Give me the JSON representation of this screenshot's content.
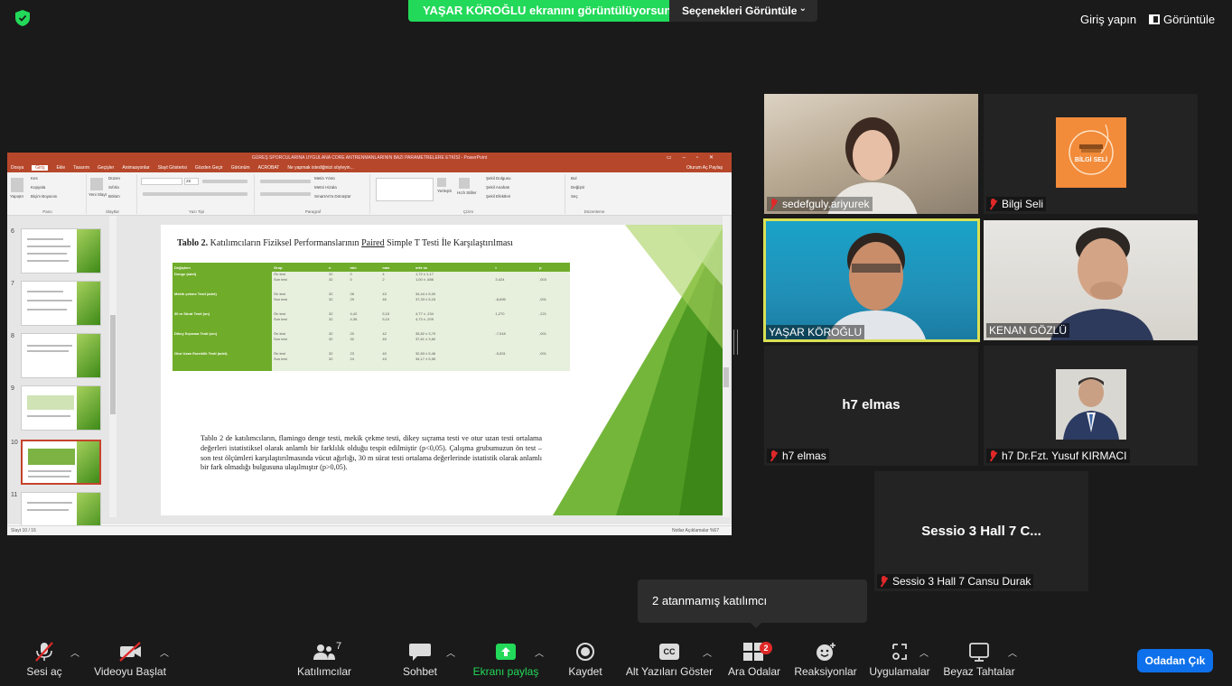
{
  "top_bar": {
    "share_banner": "YAŞAR KÖROĞLU ekranını görüntülüyorsunuz",
    "view_options": "Seçenekleri Görüntüle",
    "signin": "Giriş yapın",
    "view": "Görüntüle",
    "colors": {
      "share_green": "#23d959",
      "shield_green": "#23d959"
    }
  },
  "shared_screen": {
    "window_title": "GÜREŞ SPORCULARINA UYGULANA CORE ANTRENMANLARININ BAZI PARAMETRELERE ETKİSİ - PowerPoint",
    "tabs": [
      "Dosya",
      "Giriş",
      "Ekle",
      "Tasarım",
      "Geçişler",
      "Animasyonlar",
      "Slayt Gösterisi",
      "Gözden Geçir",
      "Görünüm",
      "ACROBAT",
      "Ne yapmak istediğinizi söyleyin..."
    ],
    "tabs_right": "Oturum Aç  Paylaş",
    "ribbon_groups": [
      "Pano",
      "Slaytlar",
      "Yazı Tipi",
      "Paragraf",
      "Çizim",
      "Düzenleme"
    ],
    "ribbon_texts": {
      "paste": "Yapıştır",
      "cut": "Kes",
      "copy": "Kopyala",
      "format_painter": "Biçim Boyacısı",
      "new_slide": "Yeni Slayt",
      "layout": "Düzen",
      "reset": "Sıfırla",
      "section": "Bölüm",
      "font_size": "28",
      "text_direction": "Metin Yönü",
      "align_text": "Metni Hizala",
      "smartart": "SmartArt'a Dönüştür",
      "arrange": "Yerleştir",
      "quick_styles": "Hızlı Stiller",
      "shape_fill": "Şekil Dolgusu",
      "shape_outline": "Şekil Anahatı",
      "shape_effects": "Şekil Efektleri",
      "find": "Bul",
      "replace": "Değiştir",
      "select": "Seç"
    },
    "thumbnail_numbers": [
      "6",
      "7",
      "8",
      "9",
      "10",
      "11"
    ],
    "slide": {
      "title_bold": "Tablo 2.",
      "title_rest": "Katılımcıların Fiziksel Performanslarının",
      "title_underlined": "Paired",
      "title_tail": "Simple T Testi İle  Karşılaştırılması",
      "table_headers": [
        "Değişken",
        "Grup",
        "n",
        "min",
        "max",
        "ort± ss",
        "t",
        "p"
      ],
      "table_rows": [
        {
          "var": "Denge (adet)",
          "rows": [
            [
              "Ön test",
              "32",
              "0",
              "4",
              "1,72  ± 1,17",
              "",
              ""
            ],
            [
              "Son test",
              "32",
              "0",
              "2",
              "1,00 ± ,686",
              "3,424",
              ",003"
            ]
          ]
        },
        {
          "var": "Mekik çekme Testi (adet)",
          "rows": [
            [
              "Ön test",
              "32",
              "26",
              "43",
              "34,44 ± 5,00",
              "",
              ""
            ],
            [
              "Son test",
              "32",
              "29",
              "46",
              "37,33 ± 5,15",
              "-8,695",
              ",001"
            ]
          ]
        },
        {
          "var": "30 m Sürat Testi (sn)",
          "rows": [
            [
              "Ön test",
              "32",
              "4,42",
              "5,15",
              "4,77 ± ,234",
              "1,270",
              ",221"
            ],
            [
              "Son test",
              "32",
              "4,36",
              "5,10",
              "4,73 ± ,209",
              "",
              ""
            ]
          ]
        },
        {
          "var": "Dikey Sıçrama Testi (cm)",
          "rows": [
            [
              "Ön test",
              "32",
              "20",
              "42",
              "35,82 ± 3,79",
              "-7,518",
              ",001"
            ],
            [
              "Son test",
              "32",
              "32",
              "45",
              "37,61 ± 3,60",
              "",
              ""
            ]
          ]
        },
        {
          "var": "Otur Uzan Esneklik Testi (adet)",
          "rows": [
            [
              "Ön test",
              "32",
              "23",
              "40",
              "32,83 ± 5,46",
              "-5,831",
              ",001"
            ],
            [
              "Son test",
              "32",
              "24",
              "43",
              "34,17 ± 5,55",
              "",
              ""
            ]
          ]
        }
      ],
      "paragraph": "Tablo 2 de katılımcıların, flamingo denge testi, mekik çekme testi, dikey sıçrama testi ve otur uzan testi ortalama değerleri istatistiksel olarak anlamlı bir farklılık olduğu tespit edilmiştir (p<0,05). Çalışma grubumuzun ön test – son test ölçümleri karşılaştırılmasında vücut ağırlığı, 30 m sürat testi ortalama değerlerinde istatistik olarak anlamlı bir fark olmadığı bulgusuna ulaşılmıştır (p>0,05)."
    },
    "status_left": "Slayt 10 / 16",
    "status_right": "Notlar   Açıklamalar          %67",
    "colors": {
      "ppt_red": "#b7472a",
      "slide_green": "#6fac29"
    }
  },
  "participants": [
    {
      "name": "sedefguly.ariyurek",
      "muted": true,
      "video": "photo"
    },
    {
      "name": "Bilgi Seli",
      "muted": true,
      "video": "logo",
      "logo_text": "BİLGİ SELİ"
    },
    {
      "name": "YAŞAR KÖROĞLU",
      "muted": false,
      "video": "photo",
      "active_speaker": true
    },
    {
      "name": "KENAN GÖZLÜ",
      "muted": false,
      "video": "photo"
    },
    {
      "name": "h7 elmas",
      "muted": true,
      "video": "off",
      "display_name": "h7 elmas"
    },
    {
      "name": "h7 Dr.Fzt. Yusuf KIRMACI",
      "muted": true,
      "video": "avatar"
    },
    {
      "name": "Sessio 3 Hall 7 Cansu Durak",
      "muted": true,
      "video": "off",
      "display_name": "Sessio 3 Hall 7 C..."
    }
  ],
  "tooltip": "2 atanmamış katılımcı",
  "toolbar": {
    "items": [
      {
        "label": "Sesi aç",
        "icon": "mic-muted-icon"
      },
      {
        "label": "Videoyu Başlat",
        "icon": "video-off-icon"
      },
      {
        "label": "Katılımcılar",
        "icon": "participants-icon",
        "count": "7"
      },
      {
        "label": "Sohbet",
        "icon": "chat-icon"
      },
      {
        "label": "Ekranı paylaş",
        "icon": "share-screen-icon"
      },
      {
        "label": "Kaydet",
        "icon": "record-icon"
      },
      {
        "label": "Alt Yazıları Göster",
        "icon": "captions-icon",
        "icon_text": "CC"
      },
      {
        "label": "Ara Odalar",
        "icon": "breakout-rooms-icon",
        "badge": "2"
      },
      {
        "label": "Reaksiyonlar",
        "icon": "reactions-icon"
      },
      {
        "label": "Uygulamalar",
        "icon": "apps-icon"
      },
      {
        "label": "Beyaz Tahtalar",
        "icon": "whiteboard-icon"
      }
    ],
    "leave": "Odadan Çık",
    "colors": {
      "leave_blue": "#0e71eb",
      "share_green": "#23d959",
      "badge_red": "#e02828"
    }
  }
}
